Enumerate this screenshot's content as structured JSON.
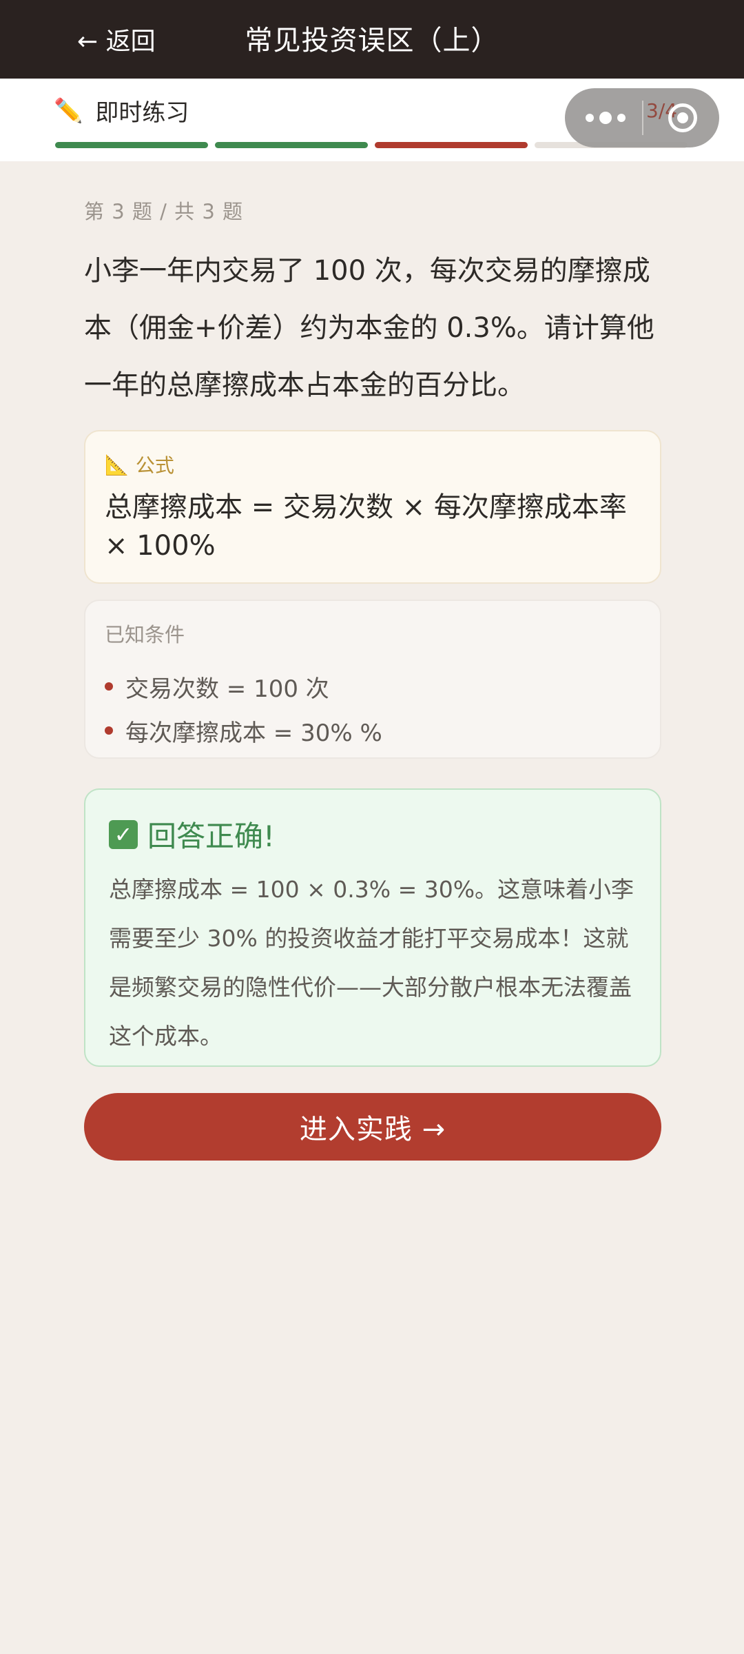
{
  "header": {
    "back_label": "← 返回",
    "title": "常见投资误区（上）"
  },
  "practice": {
    "label": "即时练习",
    "progress": [
      "done",
      "done",
      "wrong",
      "pending"
    ],
    "pager": "3/4"
  },
  "question": {
    "meta": "第 3 题 / 共 3 题",
    "text": "小李一年内交易了 100 次，每次交易的摩擦成本（佣金+价差）约为本金的 0.3%。请计算他一年的总摩擦成本占本金的百分比。"
  },
  "formula": {
    "title": "公式",
    "text": "总摩擦成本 = 交易次数 × 每次摩擦成本率 × 100%"
  },
  "known": {
    "title": "已知条件",
    "items": [
      "交易次数 = 100 次",
      "每次摩擦成本 = 30% %"
    ]
  },
  "result": {
    "status": "回答正确!",
    "text": "总摩擦成本 = 100 × 0.3% = 30%。这意味着小李需要至少 30% 的投资收益才能打平交易成本！这就是频繁交易的隐性代价——大部分散户根本无法覆盖这个成本。"
  },
  "cta": {
    "label": "进入实践 →"
  },
  "colors": {
    "header_bg": "#2a2220",
    "accent_red": "#b23d2f",
    "accent_green": "#3f8a4f",
    "page_bg": "#f3eee9"
  }
}
